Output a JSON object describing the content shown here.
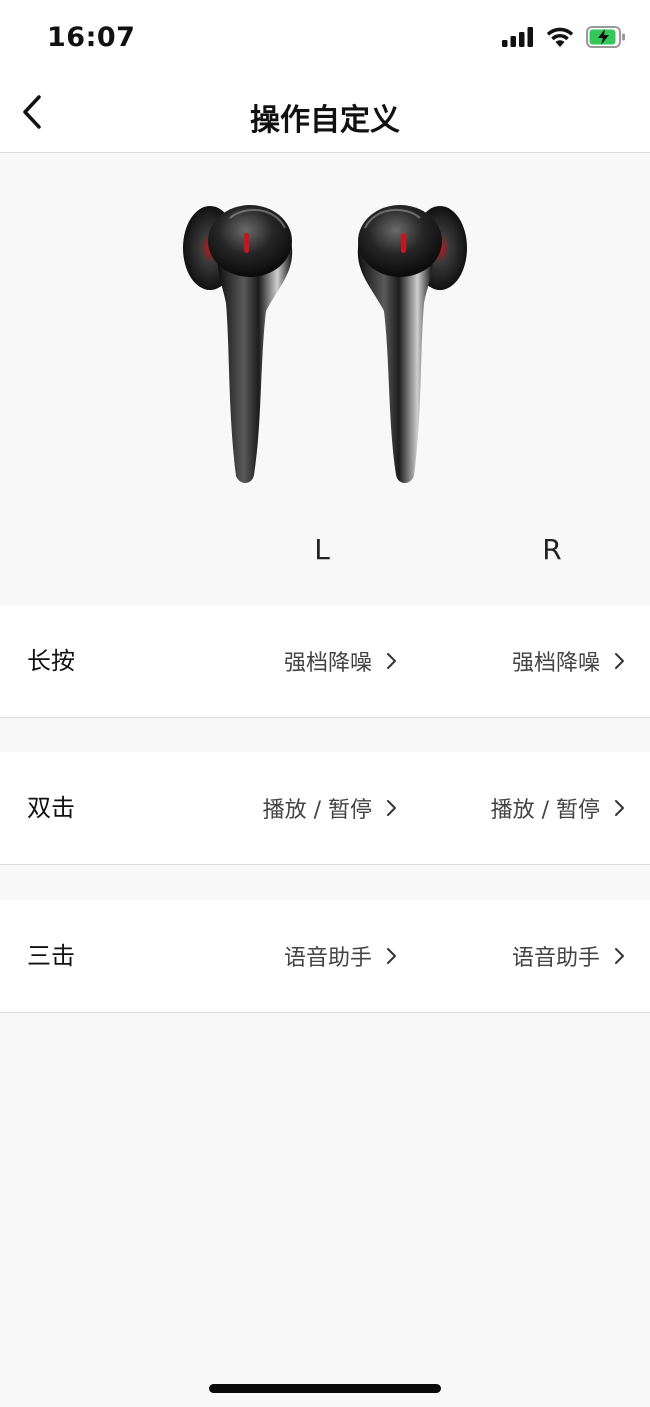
{
  "status": {
    "time": "16:07",
    "icons": [
      "signal-icon",
      "wifi-icon",
      "battery-charging-icon"
    ],
    "battery_color": "#34c759"
  },
  "nav": {
    "title": "操作自定义",
    "back_icon": "chevron-left-icon"
  },
  "hero": {
    "left_label": "L",
    "right_label": "R"
  },
  "rows": [
    {
      "label": "长按",
      "left_value": "强档降噪",
      "right_value": "强档降噪"
    },
    {
      "label": "双击",
      "left_value": "播放 / 暂停",
      "right_value": "播放 / 暂停"
    },
    {
      "label": "三击",
      "left_value": "语音助手",
      "right_value": "语音助手"
    }
  ],
  "colors": {
    "background": "#f8f8f8",
    "row_background": "#ffffff",
    "earbud_accent": "#c4161c"
  }
}
